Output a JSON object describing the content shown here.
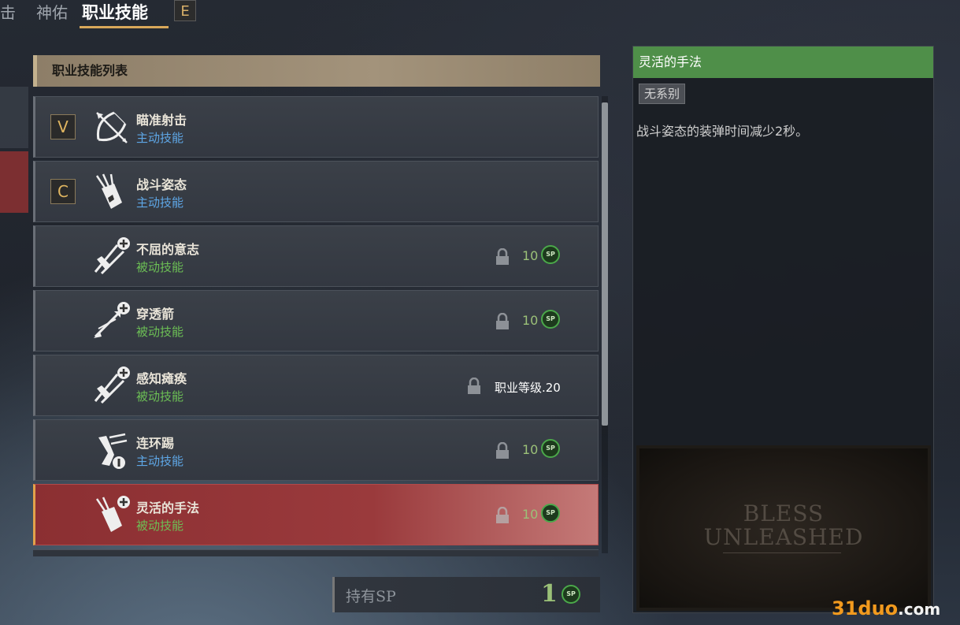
{
  "tabs": [
    {
      "label": "击"
    },
    {
      "label": "神佑"
    },
    {
      "label": "职业技能",
      "active": true
    }
  ],
  "tab_hotkey": "E",
  "list": {
    "header": "职业技能列表",
    "rows": [
      {
        "key": "V",
        "icon": "bow-arrow-icon",
        "name": "瞄准射击",
        "type": "主动技能",
        "kind": "active"
      },
      {
        "key": "C",
        "icon": "quiver-icon",
        "name": "战斗姿态",
        "type": "主动技能",
        "kind": "active"
      },
      {
        "icon": "arrows-plus-icon",
        "name": "不屈的意志",
        "type": "被动技能",
        "kind": "passive",
        "locked": true,
        "cost": "10"
      },
      {
        "icon": "arrows-plus-icon",
        "name": "穿透箭",
        "type": "被动技能",
        "kind": "passive",
        "locked": true,
        "cost": "10"
      },
      {
        "icon": "arrows-plus-icon",
        "name": "感知瘫痪",
        "type": "被动技能",
        "kind": "passive",
        "locked": true,
        "requirement": "职业等级.20"
      },
      {
        "icon": "kick-icon",
        "name": "连环踢",
        "type": "主动技能",
        "kind": "active",
        "locked": true,
        "cost": "10"
      },
      {
        "icon": "quiver-plus-icon",
        "name": "灵活的手法",
        "type": "被动技能",
        "kind": "passive",
        "locked": true,
        "cost": "10",
        "selected": true
      }
    ]
  },
  "sp_badge": "SP",
  "sp_held": {
    "label": "持有SP",
    "value": "1"
  },
  "detail": {
    "title": "灵活的手法",
    "tag": "无系别",
    "description": "战斗姿态的装弹时间减少2秒。",
    "image_logo": {
      "line1": "BLESS",
      "line2": "UNLEASHED"
    }
  },
  "watermark": {
    "main": "31duo",
    "suffix": ".com"
  },
  "colors": {
    "selected_row": "#8b2f32",
    "detail_title": "#4f8f49",
    "active_type": "#5ea7e6",
    "passive_type": "#6cbf55",
    "tab_underline": "#d8a85a"
  }
}
